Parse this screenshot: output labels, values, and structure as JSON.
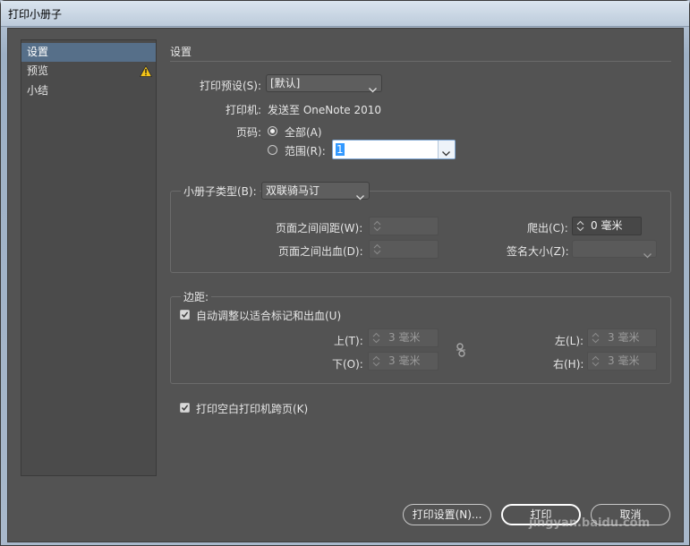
{
  "window": {
    "title": "打印小册子"
  },
  "sidebar": {
    "items": [
      {
        "label": "设置",
        "selected": true
      },
      {
        "label": "预览",
        "warning": true
      },
      {
        "label": "小结"
      }
    ],
    "warning_icon": "warning-triangle-icon"
  },
  "setup": {
    "section_title": "设置",
    "preset_label": "打印预设(S):",
    "preset_value": "[默认]",
    "printer_label": "打印机:",
    "printer_value": "发送至 OneNote 2010",
    "pages_label": "页码:",
    "all_label": "全部(A)",
    "range_label": "范围(R):",
    "range_value": "1",
    "all_selected": true
  },
  "booklet": {
    "type_label": "小册子类型(B):",
    "type_value": "双联骑马订",
    "space_label": "页面之间间距(W):",
    "space_value": "",
    "bleed_label": "页面之间出血(D):",
    "bleed_value": "",
    "creep_label": "爬出(C):",
    "creep_value": "0 毫米",
    "signature_label": "签名大小(Z):",
    "signature_value": ""
  },
  "margins": {
    "group_label": "边距:",
    "auto_label": "自动调整以适合标记和出血(U)",
    "auto_checked": true,
    "top_label": "上(T):",
    "top_value": "3 毫米",
    "bottom_label": "下(O):",
    "bottom_value": "3 毫米",
    "left_label": "左(L):",
    "left_value": "3 毫米",
    "right_label": "右(H):",
    "right_value": "3 毫米",
    "link_icon": "chain-link-broken-icon"
  },
  "options": {
    "blank_label": "打印空白打印机跨页(K)",
    "blank_checked": true
  },
  "buttons": {
    "print_setup": "打印设置(N)...",
    "print": "打印",
    "cancel": "取消"
  },
  "watermark": {
    "text": "jingyan.baidu.com"
  }
}
